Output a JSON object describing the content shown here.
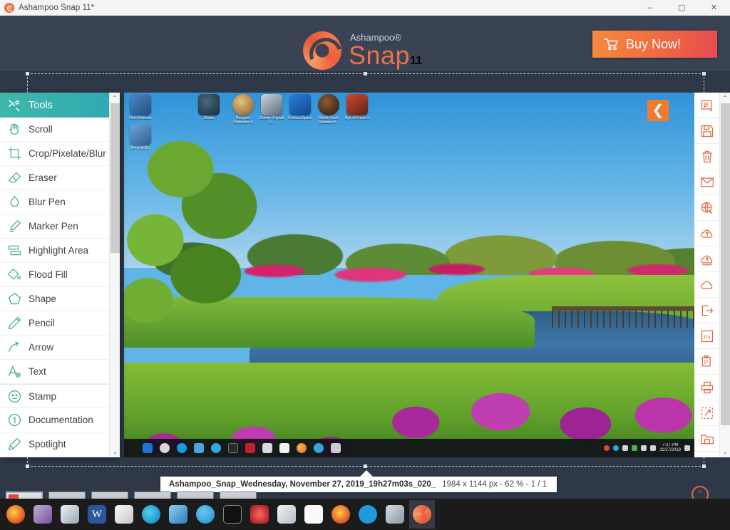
{
  "window": {
    "title": "Ashampoo Snap 11*",
    "app_icon": "ashampoo-spiral-icon",
    "controls": {
      "minimize": "–",
      "maximize": "▢",
      "close": "✕"
    }
  },
  "header": {
    "brand_sup": "Ashampoo®",
    "brand_name": "Snap",
    "brand_version": "11",
    "buy_button": {
      "label": "Buy Now!",
      "icon": "shopping-cart-icon"
    },
    "background_color": "#3a4354",
    "accent_color": "#ef6f4b"
  },
  "tools_panel": {
    "header": {
      "label": "Tools",
      "icon": "tools-icon",
      "color": "#3fb8a8"
    },
    "items": [
      {
        "label": "Scroll",
        "icon": "hand-icon"
      },
      {
        "label": "Crop/Pixelate/Blur",
        "icon": "crop-icon"
      },
      {
        "label": "Eraser",
        "icon": "eraser-icon"
      },
      {
        "label": "Blur Pen",
        "icon": "droplet-icon"
      },
      {
        "label": "Marker Pen",
        "icon": "marker-icon"
      },
      {
        "label": "Highlight Area",
        "icon": "highlight-icon"
      },
      {
        "label": "Flood Fill",
        "icon": "flood-fill-icon"
      },
      {
        "label": "Shape",
        "icon": "pentagon-icon"
      },
      {
        "label": "Pencil",
        "icon": "pencil-icon"
      },
      {
        "label": "Arrow",
        "icon": "arrow-icon"
      },
      {
        "label": "Text",
        "icon": "text-a-icon"
      },
      {
        "label": "Stamp",
        "icon": "smiley-icon"
      },
      {
        "label": "Documentation",
        "icon": "numbered-circle-icon"
      },
      {
        "label": "Spotlight",
        "icon": "spotlight-icon"
      }
    ],
    "scroll_up": "⌃",
    "scroll_down": "⌄"
  },
  "right_toolbar": {
    "accent_color": "#e0683f",
    "items": [
      {
        "name": "notes-edit-icon"
      },
      {
        "name": "save-floppy-icon"
      },
      {
        "name": "trash-delete-icon"
      },
      {
        "name": "email-envelope-icon"
      },
      {
        "name": "web-upload-icon"
      },
      {
        "name": "cloud-upload-icon"
      },
      {
        "name": "cloud-sync-icon"
      },
      {
        "name": "cloud-icon"
      },
      {
        "name": "export-icon"
      },
      {
        "name": "photoshop-icon",
        "label": "Ps"
      },
      {
        "name": "clipboard-icon"
      },
      {
        "name": "print-icon"
      },
      {
        "name": "share-expand-icon"
      },
      {
        "name": "save-folder-icon"
      },
      {
        "name": "document-icon"
      }
    ]
  },
  "canvas": {
    "collapse_arrow": "❮",
    "desktop_icons": [
      {
        "label": "Steam",
        "color": "#1b2838"
      },
      {
        "label": "Dungeon Defenders II",
        "color": "#b07c3a"
      },
      {
        "label": "Divinity Original S...",
        "color": "#7d8ea0"
      },
      {
        "label": "Endless Space",
        "color": "#1e5aa8"
      },
      {
        "label": "Middle-Earth Shadow of...",
        "color": "#4a2a18"
      },
      {
        "label": "Age of Empires",
        "color": "#8a3b2a"
      }
    ],
    "side_icons": [
      {
        "label": "Hotel Network",
        "color": "#2f6fb5"
      },
      {
        "label": "Recycle Bin",
        "color": "#3b6fa0"
      }
    ],
    "taskbar_items": [
      "start-icon",
      "cortana-icon",
      "edge-icon",
      "explorer-icon",
      "telegram-icon",
      "terminal-icon",
      "maple-icon",
      "camera-icon",
      "mail-icon",
      "firefox-icon",
      "skype-icon",
      "notes-icon"
    ],
    "tray": {
      "time": "7:27 PM",
      "date": "11/27/2019"
    }
  },
  "status_bar": {
    "file_name": "Ashampoo_Snap_Wednesday, November 27, 2019_19h27m03s_020_",
    "image_info": "1984 x 1144 px - 62 % - 1 / 1"
  },
  "thumbnails": {
    "count": 6,
    "selected_index": 0
  },
  "nav_arrows": {
    "up": "⌃",
    "left": "❮",
    "right": "❯"
  },
  "windows_taskbar": {
    "items": [
      {
        "name": "firefox-icon",
        "color": "#e8612a"
      },
      {
        "name": "onenote-icon",
        "color": "#7a4c9e"
      },
      {
        "name": "paint3d-icon",
        "color": "#d0d4da"
      },
      {
        "name": "word-icon",
        "color": "#2b579a",
        "label": "W"
      },
      {
        "name": "ashampoo-icon",
        "color": "#dcdcdc"
      },
      {
        "name": "edge-icon",
        "color": "#1b9ae0"
      },
      {
        "name": "explorer-icon",
        "color": "#f0c040"
      },
      {
        "name": "telegram-icon",
        "color": "#30a3dc"
      },
      {
        "name": "terminal-icon",
        "color": "#1b1b1b"
      },
      {
        "name": "maple-icon",
        "color": "#c31f2e"
      },
      {
        "name": "camera-icon",
        "color": "#d6d9dd"
      },
      {
        "name": "mail-icon",
        "color": "#f2f2f2"
      },
      {
        "name": "chrome-icon",
        "color": "#e8612a"
      },
      {
        "name": "lock-icon",
        "color": "#1f9ae0"
      },
      {
        "name": "map-icon",
        "color": "#9aa6b2"
      },
      {
        "name": "snap-active-icon",
        "color": "#e8663c"
      }
    ],
    "active_index": 15
  }
}
